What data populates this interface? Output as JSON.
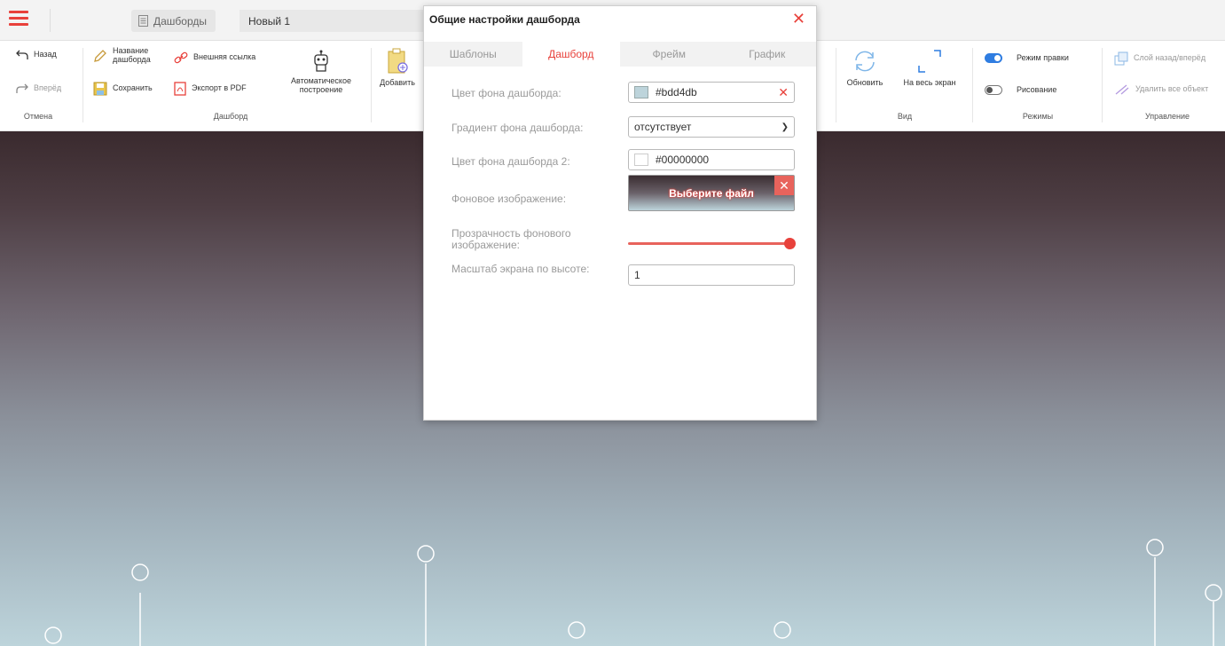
{
  "topbar": {
    "dashboards_tab": "Дашборды",
    "current_tab": "Новый 1"
  },
  "ribbon": {
    "back": "Назад",
    "forward": "Вперёд",
    "undo_group": "Отмена",
    "dashboard_name": "Название дашборда",
    "external_link": "Внешняя ссылка",
    "save": "Сохранить",
    "export_pdf": "Экспорт в PDF",
    "auto_build": "Автоматическое построение",
    "dashboard_group": "Дашборд",
    "add": "Добавить",
    "refresh": "Обновить",
    "fullscreen": "На весь экран",
    "view_group": "Вид",
    "edit_mode": "Режим правки",
    "drawing": "Рисование",
    "modes_group": "Режимы",
    "layer_order": "Слой назад/вперёд",
    "delete_all": "Удалить все объект",
    "manage_group": "Управление"
  },
  "dialog": {
    "title": "Общие настройки дашборда",
    "tabs": [
      "Шаблоны",
      "Дашборд",
      "Фрейм",
      "График"
    ],
    "active_tab": 1,
    "bg_color_label": "Цвет фона дашборда:",
    "bg_color_value": "#bdd4db",
    "gradient_label": "Градиент фона дашборда:",
    "gradient_value": "отсутствует",
    "bg_color2_label": "Цвет фона дашборда 2:",
    "bg_color2_value": "#00000000",
    "bg_image_label": "Фоновое изображение:",
    "choose_file": "Выберите файл",
    "opacity_label": "Прозрачность фонового изображение:",
    "opacity_value": 1.0,
    "scale_label": "Масштаб экрана по высоте:",
    "scale_value": "1"
  },
  "colors": {
    "accent": "#e8413b",
    "bg_color": "#bdd4db",
    "toggle_on": "#2f7de1"
  }
}
